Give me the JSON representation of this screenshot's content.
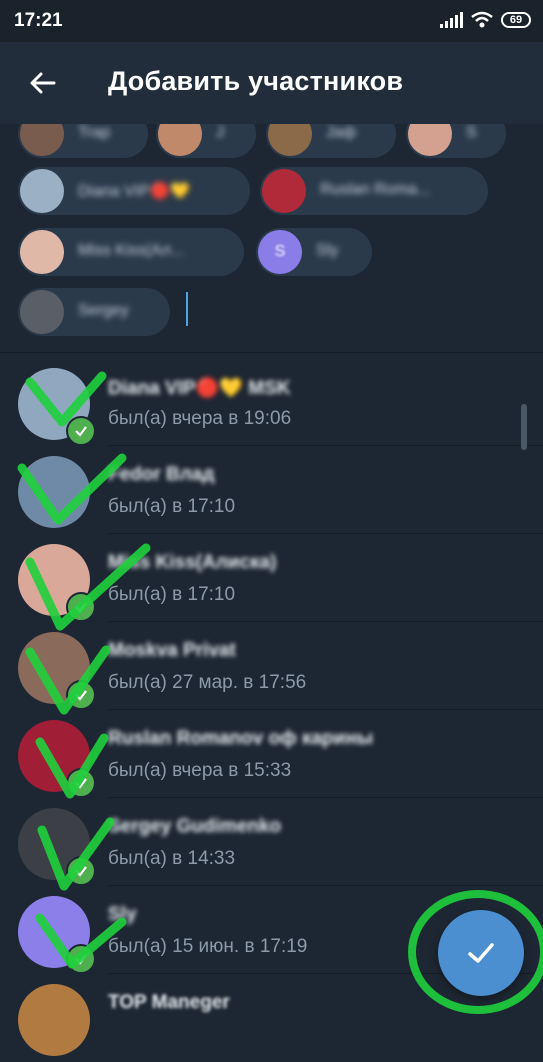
{
  "status_bar": {
    "time": "17:21",
    "battery": "69"
  },
  "toolbar": {
    "title": "Добавить участников"
  },
  "chips": [
    {
      "name": "Trap",
      "color": "#7a5c4e"
    },
    {
      "name": "J",
      "color": "#c08a6a"
    },
    {
      "name": "Jaф",
      "color": "#8b6a4a"
    },
    {
      "name": "S",
      "color": "#d4a090"
    },
    {
      "name": "Diana VIP🔴💛",
      "color": "#9bb0c4"
    },
    {
      "name": "Ruslan Roma...",
      "color": "#b02a3a"
    },
    {
      "name": "Miss Kiss(Ал...",
      "color": "#e0b8a8"
    },
    {
      "name": "Sly",
      "color": "#8a7de8",
      "initial": "S"
    },
    {
      "name": "Sergey",
      "color": "#5a5e66"
    }
  ],
  "contacts": [
    {
      "name": "Diana VIP🔴💛 MSK",
      "status": "был(а) вчера в 19:06",
      "color": "#8fa7bf"
    },
    {
      "name": "Fedor Влад",
      "status": "был(а) в 17:10",
      "color": "#6f8aa6"
    },
    {
      "name": "Miss Kiss(Алиска)",
      "status": "был(а) в 17:10",
      "color": "#d9a898"
    },
    {
      "name": "Moskva Privat",
      "status": "был(а) 27 мар. в 17:56",
      "color": "#8a6a5a"
    },
    {
      "name": "Ruslan Romanov оф карины",
      "status": "был(а) вчера в 15:33",
      "color": "#a01e36"
    },
    {
      "name": "Sergey Gudimenko",
      "status": "был(а) в 14:33",
      "color": "#3c3f46"
    },
    {
      "name": "Sly",
      "status": "был(а) 15 июн. в 17:19",
      "color": "#8d7fea"
    },
    {
      "name": "TOP Maneger",
      "status": "",
      "color": "#b07a40"
    }
  ],
  "colors": {
    "accent": "#4b8fd0",
    "check": "#4fae4e",
    "annotation": "#1fd13c"
  }
}
